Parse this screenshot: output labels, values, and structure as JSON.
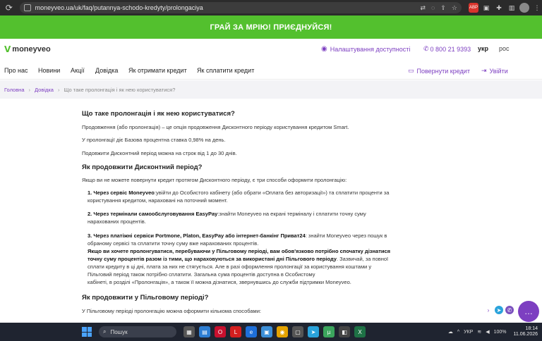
{
  "browser": {
    "url": "moneyveo.ua/uk/faq/putannya-schodo-kredyty/prolongaciya"
  },
  "banner": {
    "text": "ГРАЙ ЗА МРІЮ! ПРИЄДНУЙСЯ!"
  },
  "header": {
    "logo": "moneyveo",
    "accessibility": "Налаштування доступності",
    "phone": "0 800 21 9393",
    "lang_active": "укр",
    "lang_other": "рос"
  },
  "nav": {
    "items": [
      "Про нас",
      "Новини",
      "Акції",
      "Довідка",
      "Як отримати кредит",
      "Як сплатити кредит"
    ],
    "return_credit": "Повернути кредит",
    "login": "Увійти"
  },
  "breadcrumb": {
    "home": "Головна",
    "help": "Довідка",
    "current": "Що таке пролонгація і як нею користуватися?"
  },
  "content": {
    "h1": "Що таке пролонгація і як нею користуватися?",
    "p1": "Продовження (або пролонгація) – це опція продовження Дисконтного періоду користування кредитом Smart.",
    "p2": "У пролонгації діє Базова процентна ставка 0,98% на день.",
    "p3": "Подовжити Дисконтний період можна на строк від 1 до 30 днів.",
    "h2": "Як продовжити Дисконтний період?",
    "p4": "Якщо ви не можете повернути кредит протягом Дисконтного періоду, є три способи оформити пролонгацію:",
    "li1_bold": "1. Через сервіс Moneyveo",
    "li1_a": ":увійти до Особистого кабінету (або обрати «Оплата без авторизації») та сплатити проценти за",
    "li1_b": "користування кредитом, нараховані на поточний момент.",
    "li2_bold": "2. Через термінали самообслуговування EasyPay",
    "li2_a": ":знайти Moneyveo на екрані терміналу і сплатити точну суму",
    "li2_b": "нарахованих процентів.",
    "li3_bold": "3. Через платіжні сервіси Portmone, Platon, EasyPay або інтернет-банкінг Приват24",
    "li3_a": ": знайти Moneyveo через пошук в",
    "li3_b": "обраному сервісі та сплатити точну суму вже нарахованих процентів.",
    "li3_c": "Якщо ви хочете пролонгуватися, перебуваючи у Пільговому періоді, вам обов'язково потрібно спочатку дізнатися",
    "li3_d_bold": "точну суму процентів разом із тими, що нараховуються за використані дні Пільгового періоду",
    "li3_d": ". Зазвичай, за повної",
    "li3_e": "сплати кредиту в ці дні, плата за них не стягується. Але в разі оформлення пролонгації за користування коштами у",
    "li3_f": "Пільговий період також потрібно сплатити. Загальна сума процентів доступна в Особистому",
    "li3_g": "кабінеті, в розділі «Пролонгація», а також її можна дізнатися, звернувшись до служби підтримки Moneyveo.",
    "h3": "Як продовжити у Пільговому періоді?",
    "p5": "У Пільговому періоді пролонгацію можна оформити кількома способами:"
  },
  "taskbar": {
    "search": "Пошук",
    "lang": "УКР",
    "battery": "100%",
    "time": "18:14",
    "date": "11.06.2026"
  },
  "colors": {
    "green": "#53c02e",
    "purple": "#7d3fc1"
  }
}
